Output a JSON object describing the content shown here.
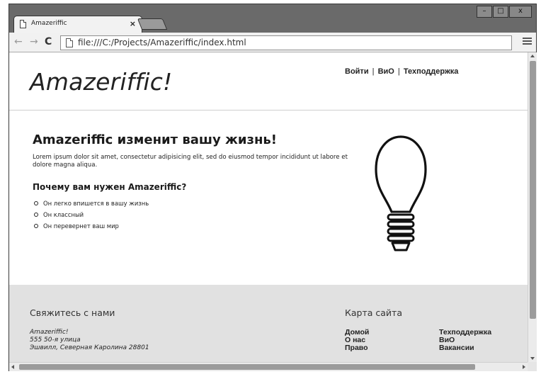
{
  "tab": {
    "title": "Amazeriffic",
    "close_glyph": "×"
  },
  "window_controls": {
    "minimize": "–",
    "maximize": "□",
    "close": "x"
  },
  "toolbar": {
    "back_glyph": "←",
    "forward_glyph": "→",
    "reload_glyph": "C",
    "url": "file:///C:/Projects/Amazeriffic/index.html"
  },
  "site": {
    "logo": "Amazeriffic!",
    "nav": [
      {
        "label": "Войти"
      },
      {
        "label": "ВиО"
      },
      {
        "label": "Техподдержка"
      }
    ],
    "nav_separator": "|"
  },
  "main": {
    "headline": "Amazeriffic изменит вашу жизнь!",
    "lead": "Lorem ipsum dolor sit amet, consectetur adipisicing elit, sed do eiusmod tempor incididunt ut labore et dolore magna aliqua.",
    "why_title": "Почему вам нужен Amazeriffic?",
    "reasons": [
      "Он легко впишется в вашу жизнь",
      "Он классный",
      "Он перевернет ваш мир"
    ]
  },
  "footer": {
    "contact_title": "Свяжитесь с нами",
    "company": "Amazeriffic!",
    "street": "555 50-я улица",
    "city": "Эшвилл, Северная Каролина 28801",
    "sitemap_title": "Карта сайта",
    "sitemap_col1": [
      "Домой",
      "О нас",
      "Право"
    ],
    "sitemap_col2": [
      "Техподдержка",
      "ВиО",
      "Вакансии"
    ]
  }
}
